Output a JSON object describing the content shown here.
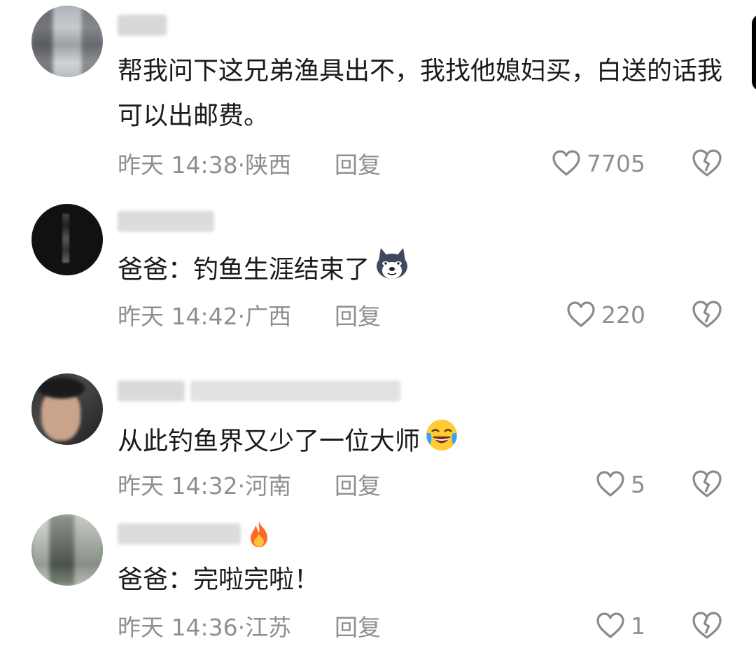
{
  "comments": [
    {
      "text": "帮我问下这兄弟渔具出不，我找他媳妇买，白送的话我可以出邮费。",
      "time": "昨天 14:38·",
      "location": "陕西",
      "reply_label": "回复",
      "likes": "7705",
      "avatar_icon": "user-avatar-pixelated",
      "like_icon": "heart-outline-icon",
      "dislike_icon": "broken-heart-icon"
    },
    {
      "text": "爸爸：钓鱼生涯结束了",
      "emoji": "husky-dog-emoji",
      "time": "昨天 14:42·",
      "location": "广西",
      "reply_label": "回复",
      "likes": "220",
      "avatar_icon": "user-avatar-pixelated",
      "like_icon": "heart-outline-icon",
      "dislike_icon": "broken-heart-icon"
    },
    {
      "text": "从此钓鱼界又少了一位大师",
      "emoji": "crying-laughing-emoji",
      "time": "昨天 14:32·",
      "location": "河南",
      "reply_label": "回复",
      "likes": "5",
      "avatar_icon": "user-avatar-pixelated",
      "like_icon": "heart-outline-icon",
      "dislike_icon": "broken-heart-icon"
    },
    {
      "text": "爸爸：完啦完啦！",
      "name_badge": "fire-icon",
      "time": "昨天 14:36·",
      "location": "江苏",
      "reply_label": "回复",
      "likes": "1",
      "avatar_icon": "user-avatar-pixelated",
      "like_icon": "heart-outline-icon",
      "dislike_icon": "broken-heart-icon"
    }
  ],
  "colors": {
    "text": "#1a1a1a",
    "meta": "#8f8f8f",
    "background": "#ffffff"
  }
}
